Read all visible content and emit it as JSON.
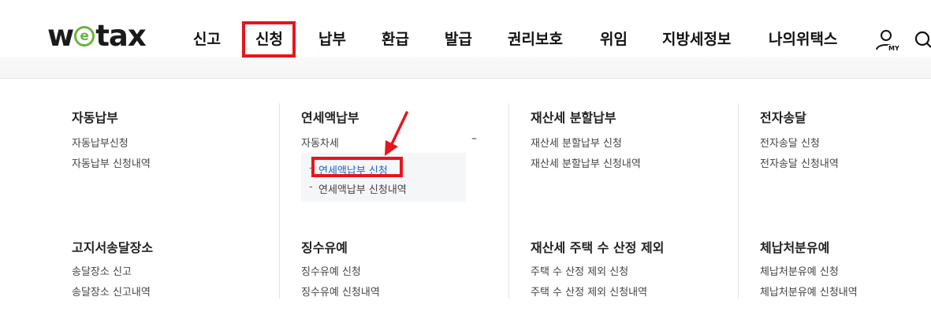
{
  "logo": {
    "before": "w",
    "middle": "e",
    "after": "tax"
  },
  "nav": {
    "items": [
      "신고",
      "신청",
      "납부",
      "환급",
      "발급",
      "권리보호",
      "위임",
      "지방세정보",
      "나의위택스"
    ],
    "my_badge": "MY"
  },
  "menu": {
    "col1": {
      "title1": "자동납부",
      "links1": [
        "자동납부신청",
        "자동납부 신청내역"
      ],
      "title2": "고지서송달장소",
      "links2": [
        "송달장소 신고",
        "송달장소 신고내역"
      ]
    },
    "col2": {
      "title1": "연세액납부",
      "link1": "자동차세",
      "toggle": "–",
      "sub_items": [
        "연세액납부 신청",
        "연세액납부 신청내역"
      ],
      "sub_bullet": "-",
      "title2": "징수유예",
      "links2": [
        "징수유예 신청",
        "징수유예 신청내역"
      ]
    },
    "col3": {
      "title1": "재산세 분할납부",
      "links1": [
        "재산세 분할납부 신청",
        "재산세 분할납부 신청내역"
      ],
      "title2": "재산세 주택 수 산정 제외",
      "links2": [
        "주택 수 산정 제외 신청",
        "주택 수 산정 제외 신청내역"
      ]
    },
    "col4": {
      "title1": "전자송달",
      "links1": [
        "전자송달 신청",
        "전자송달 신청내역"
      ],
      "title2": "체납처분유예",
      "links2": [
        "체납처분유예 신청",
        "체납처분유예 신청내역"
      ]
    }
  },
  "colors": {
    "highlight": "#e8141c",
    "active_link": "#1e63d6",
    "logo_green": "#6cb33f"
  }
}
